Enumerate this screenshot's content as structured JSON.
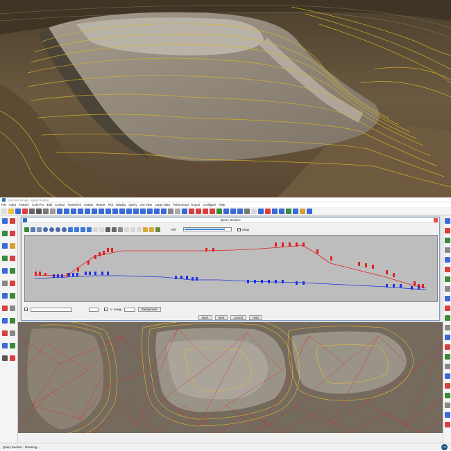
{
  "window": {
    "title": "Civil Site Design - Query Section"
  },
  "menu": [
    "File",
    "Input",
    "Feature",
    "CAD-Pro",
    "Edit",
    "Control",
    "Transform",
    "Output",
    "Report",
    "Plot",
    "Display",
    "Query",
    "3-D View",
    "Large Data",
    "Point Cloud",
    "Export",
    "Configure",
    "Help"
  ],
  "dialog": {
    "title": "Query Section",
    "ref_label": "Ref",
    "snap_label": "Snap",
    "snap_checked": "✓",
    "v_exag_label": "V. exagg",
    "background_button": "Background",
    "buttons": [
      "Back",
      "Next",
      "Cancel",
      "Help"
    ]
  },
  "status": {
    "text": "Query Section - Roaming...",
    "logo": "LSA"
  },
  "colors": {
    "surface_upper": "#e02020",
    "surface_lower": "#2030e0",
    "plot_bg": "#bdbdbd"
  }
}
